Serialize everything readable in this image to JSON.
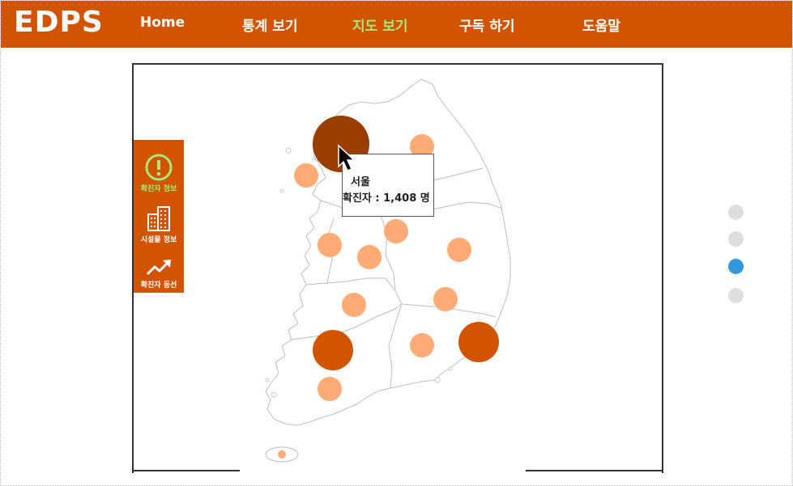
{
  "app": {
    "logo": "EDPS"
  },
  "nav": {
    "items": [
      {
        "label": "Home"
      },
      {
        "label": "통계 보기"
      },
      {
        "label": "지도 보기",
        "active": true
      },
      {
        "label": "구독 하기"
      },
      {
        "label": "도움말"
      }
    ]
  },
  "side_menu": {
    "items": [
      {
        "label": "확진자 정보",
        "icon": "alert-circle-icon",
        "active": true
      },
      {
        "label": "시설물 정보",
        "icon": "building-icon"
      },
      {
        "label": "확진자 동선",
        "icon": "trending-up-icon"
      }
    ]
  },
  "tooltip": {
    "region": "서울",
    "count_text": "확진자 : 1,408 명"
  },
  "colors": {
    "brand": "#d35400",
    "active_nav": "#a5e879",
    "bubble_light": "#ffab76",
    "bubble_medium": "#d35400",
    "bubble_dark": "#9a3d00",
    "pager_active": "#3498db",
    "pager_inactive": "#dedede"
  },
  "pager": {
    "count": 4,
    "active_index": 2
  }
}
